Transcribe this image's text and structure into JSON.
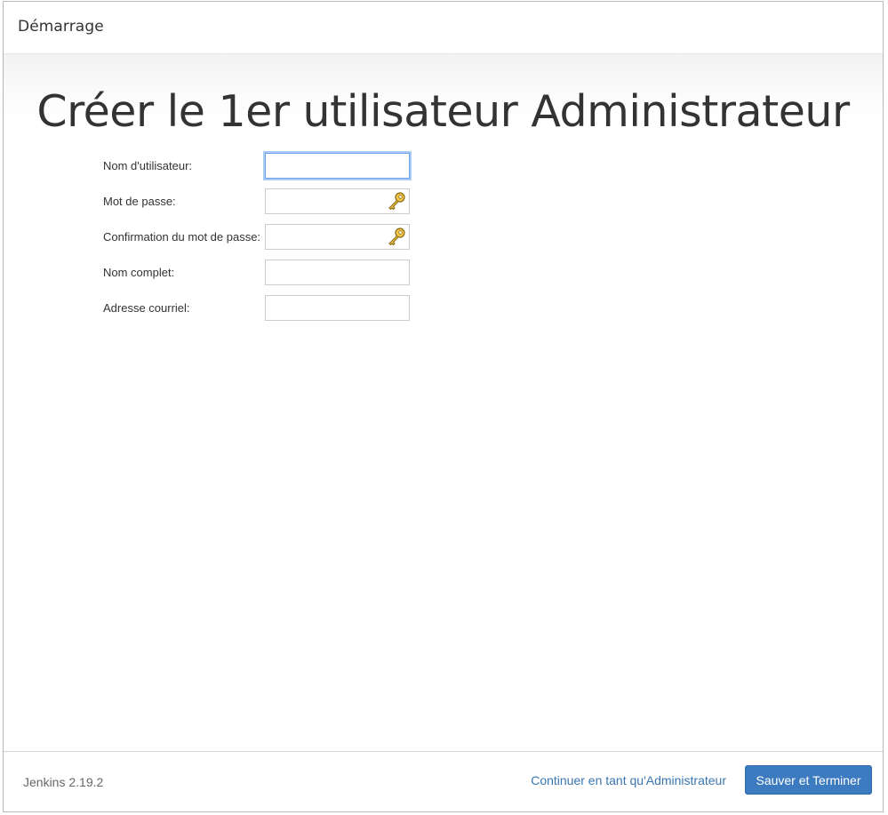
{
  "header": {
    "title": "Démarrage"
  },
  "main": {
    "heading": "Créer le 1er utilisateur Administrateur",
    "fields": [
      {
        "label": "Nom d'utilisateur:",
        "value": "",
        "type": "text",
        "focused": true
      },
      {
        "label": "Mot de passe:",
        "value": "",
        "type": "password",
        "icon": "key-icon"
      },
      {
        "label": "Confirmation du mot de passe:",
        "value": "",
        "type": "password",
        "icon": "key-icon"
      },
      {
        "label": "Nom complet:",
        "value": "",
        "type": "text"
      },
      {
        "label": "Adresse courriel:",
        "value": "",
        "type": "text"
      }
    ]
  },
  "footer": {
    "version": "Jenkins 2.19.2",
    "continue_label": "Continuer en tant qu'Administrateur",
    "save_label": "Sauver et Terminer"
  },
  "colors": {
    "primary_button": "#3d7bc0",
    "link": "#3a75b0",
    "focus": "#69a3e8",
    "key_icon": "#e0b53a"
  }
}
